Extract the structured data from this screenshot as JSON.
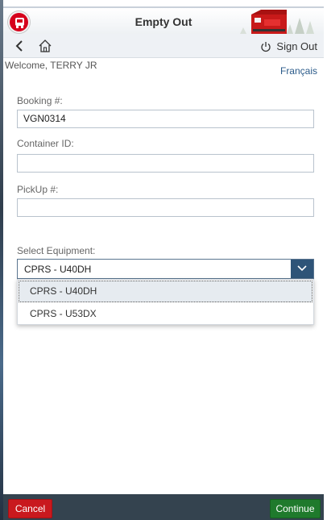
{
  "header": {
    "title": "Empty Out",
    "logo_icon": "cp-rail-logo-icon",
    "train_icon": "locomotive-icon",
    "brand_color": "#d6001c"
  },
  "subheader": {
    "back_icon": "chevron-left-icon",
    "home_icon": "home-icon",
    "signout_icon": "power-icon",
    "signout_label": "Sign Out"
  },
  "welcome": "Welcome, TERRY JR",
  "language_link": "Français",
  "form": {
    "booking_label": "Booking #:",
    "booking_value": "VGN0314",
    "container_label": "Container ID:",
    "container_value": "",
    "pickup_label": "PickUp #:",
    "pickup_value": "",
    "equipment_label": "Select Equipment:",
    "equipment_selected": "CPRS - U40DH",
    "equipment_options": [
      "CPRS - U40DH",
      "CPRS - U53DX"
    ]
  },
  "footer": {
    "cancel_label": "Cancel",
    "continue_label": "Continue",
    "cancel_color": "#c9191e",
    "continue_color": "#1f7a2c"
  }
}
